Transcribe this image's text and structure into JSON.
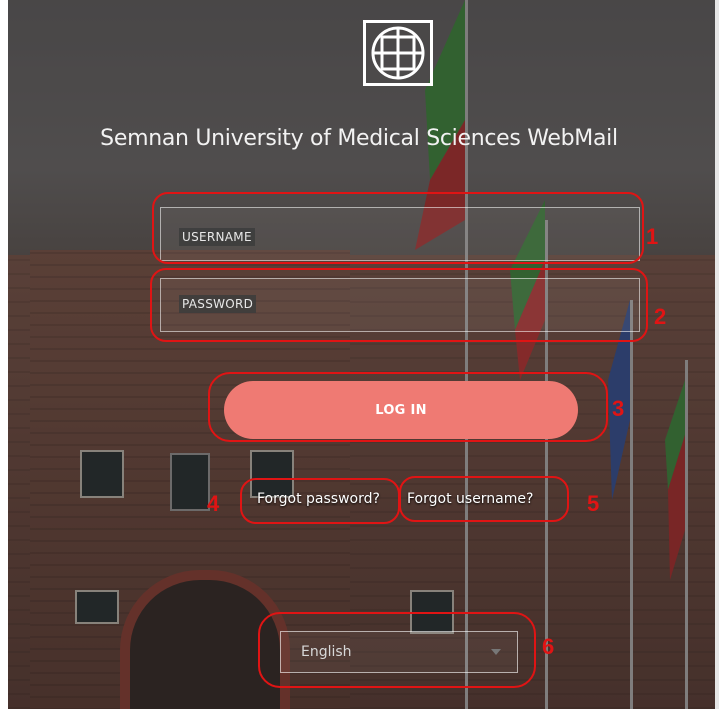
{
  "header": {
    "title": "Semnan University of Medical Sciences WebMail"
  },
  "login_form": {
    "username_placeholder": "USERNAME",
    "password_placeholder": "PASSWORD",
    "login_label": "LOG IN",
    "forgot_password_label": "Forgot password?",
    "forgot_username_label": "Forgot username?"
  },
  "language_select": {
    "selected": "English"
  },
  "annotations": [
    "1",
    "2",
    "3",
    "4",
    "5",
    "6"
  ],
  "colors": {
    "login_button": "#ef7a73",
    "annotation": "#e01414"
  },
  "icons": {
    "logo": "university-emblem-icon",
    "select_caret": "caret-down-icon"
  }
}
